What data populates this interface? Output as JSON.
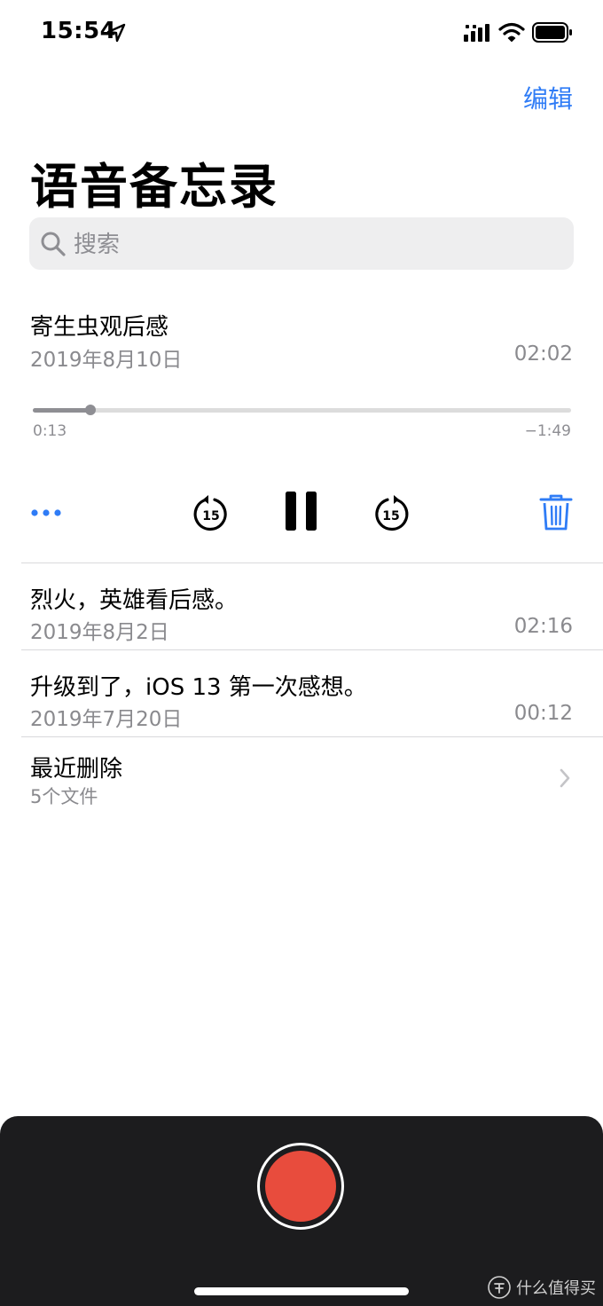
{
  "status_bar": {
    "time": "15:54"
  },
  "header": {
    "edit_label": "编辑",
    "title": "语音备忘录"
  },
  "search": {
    "placeholder": "搜索"
  },
  "expanded_recording": {
    "title": "寄生虫观后感",
    "date": "2019年8月10日",
    "duration": "02:02",
    "elapsed": "0:13",
    "remaining": "−1:49",
    "progress_fraction": 0.107,
    "skip_seconds": "15"
  },
  "recordings": [
    {
      "title": "烈火，英雄看后感。",
      "date": "2019年8月2日",
      "duration": "02:16"
    },
    {
      "title": "升级到了，iOS 13 第一次感想。",
      "date": "2019年7月20日",
      "duration": "00:12"
    }
  ],
  "recently_deleted": {
    "label": "最近删除",
    "count": "5个文件"
  },
  "watermark": {
    "text": "什么值得买"
  },
  "colors": {
    "accent": "#2f7cf6",
    "record": "#e84c3d",
    "panel": "#1c1c1e",
    "secondary_text": "#8a8a8e"
  }
}
